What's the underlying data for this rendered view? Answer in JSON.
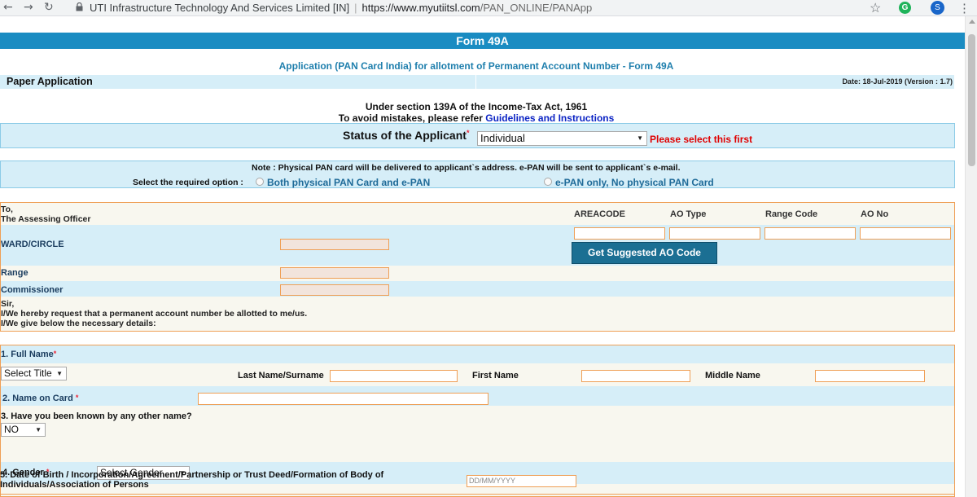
{
  "browser": {
    "site_identity": "UTI Infrastructure Technology And Services Limited [IN]",
    "url_host": "https://www.myutiitsl.com",
    "url_path": "/PAN_ONLINE/PANApp",
    "profile_initial": "S",
    "extension_initial": "G"
  },
  "header": {
    "form_title": "Form 49A",
    "subtitle": "Application (PAN Card India) for allotment of Permanent Account Number - Form 49A",
    "paper_label": "Paper Application",
    "date_version": "Date: 18-Jul-2019 (Version : 1.7)"
  },
  "intro": {
    "section_line": "Under section 139A of the Income-Tax Act, 1961",
    "mistakes_prefix": "To avoid mistakes, please refer",
    "guidelines_link": "Guidelines and Instructions"
  },
  "status": {
    "label": "Status of the Applicant",
    "required_mark": "*",
    "selected": "Individual",
    "warning": "Please select this first"
  },
  "pan_option": {
    "note": "Note  :  Physical PAN card will be delivered to applicant`s address.   e-PAN will be sent to applicant`s e-mail.",
    "select_label": "Select the required option :",
    "option_both": "Both physical PAN Card and e-PAN",
    "option_epan": "e-PAN only, No physical PAN Card"
  },
  "ao": {
    "to_line1": "To,",
    "to_line2": "The Assessing Officer",
    "headers": [
      "AREACODE",
      "AO Type",
      "Range Code",
      "AO No"
    ],
    "ward_label": "WARD/CIRCLE",
    "range_label": "Range",
    "commissioner_label": "Commissioner",
    "suggest_button": "Get Suggested AO Code",
    "sir_line1": "Sir,",
    "sir_line2": "I/We hereby request that a permanent account number be allotted to me/us.",
    "sir_line3": "I/We give below the necessary details:"
  },
  "details": {
    "full_name_label": "1. Full Name",
    "required_mark": "*",
    "title_select": "Select Title",
    "last_name_label": "Last Name/Surname",
    "first_name_label": "First Name",
    "middle_name_label": "Middle Name",
    "name_on_card_label": "2. Name on Card",
    "known_other_label": "3. Have you been known by any other name?",
    "known_other_value": "NO",
    "gender_label": "4. Gender",
    "gender_select": "Select Gender",
    "dob_label_line1": "5. Date of Birth / Incorporation/Agreement/Partnership or Trust Deed/Formation of Body of",
    "dob_label_line2": "Individuals/Association of Persons",
    "dob_placeholder": "DD/MM/YYYY"
  }
}
